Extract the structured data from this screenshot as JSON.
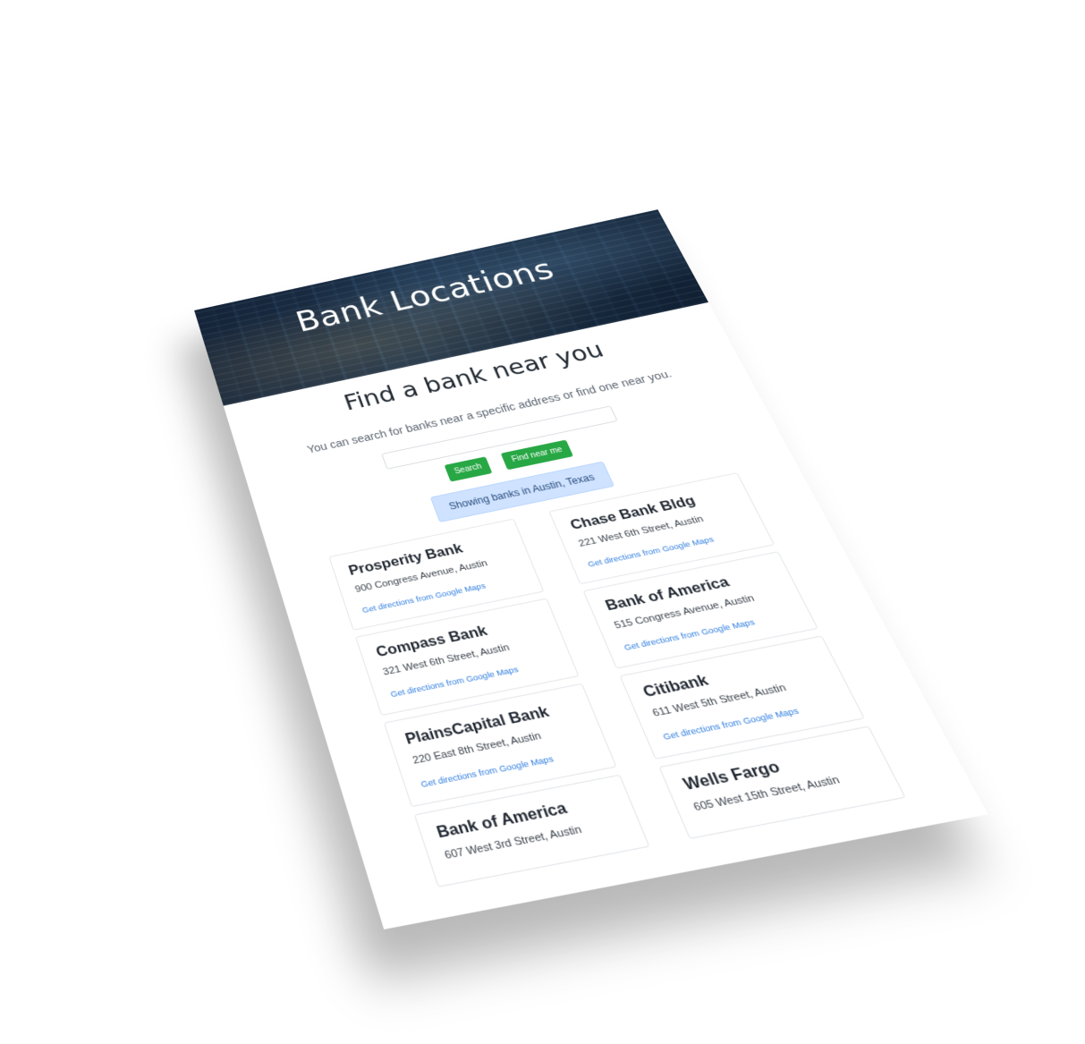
{
  "hero": {
    "title": "Bank Locations"
  },
  "main": {
    "heading": "Find a bank near you",
    "subtitle": "You can search for banks near a specific address or find one near you.",
    "search_value": "",
    "search_label": "Search",
    "near_me_label": "Find near me",
    "status": "Showing banks in Austin, Texas"
  },
  "results": {
    "left": [
      {
        "name": "Prosperity Bank",
        "address": "900 Congress Avenue, Austin",
        "link": "Get directions from Google Maps"
      },
      {
        "name": "Compass Bank",
        "address": "321 West 6th Street, Austin",
        "link": "Get directions from Google Maps"
      },
      {
        "name": "PlainsCapital Bank",
        "address": "220 East 8th Street, Austin",
        "link": "Get directions from Google Maps"
      },
      {
        "name": "Bank of America",
        "address": "607 West 3rd Street, Austin",
        "link": ""
      }
    ],
    "right": [
      {
        "name": "Chase Bank Bldg",
        "address": "221 West 6th Street, Austin",
        "link": "Get directions from Google Maps"
      },
      {
        "name": "Bank of America",
        "address": "515 Congress Avenue, Austin",
        "link": "Get directions from Google Maps"
      },
      {
        "name": "Citibank",
        "address": "611 West 5th Street, Austin",
        "link": "Get directions from Google Maps"
      },
      {
        "name": "Wells Fargo",
        "address": "605 West 15th Street, Austin",
        "link": ""
      }
    ]
  },
  "colors": {
    "button_green": "#28a745",
    "alert_blue": "#cfe2ff",
    "link_blue": "#2f7ee0"
  }
}
